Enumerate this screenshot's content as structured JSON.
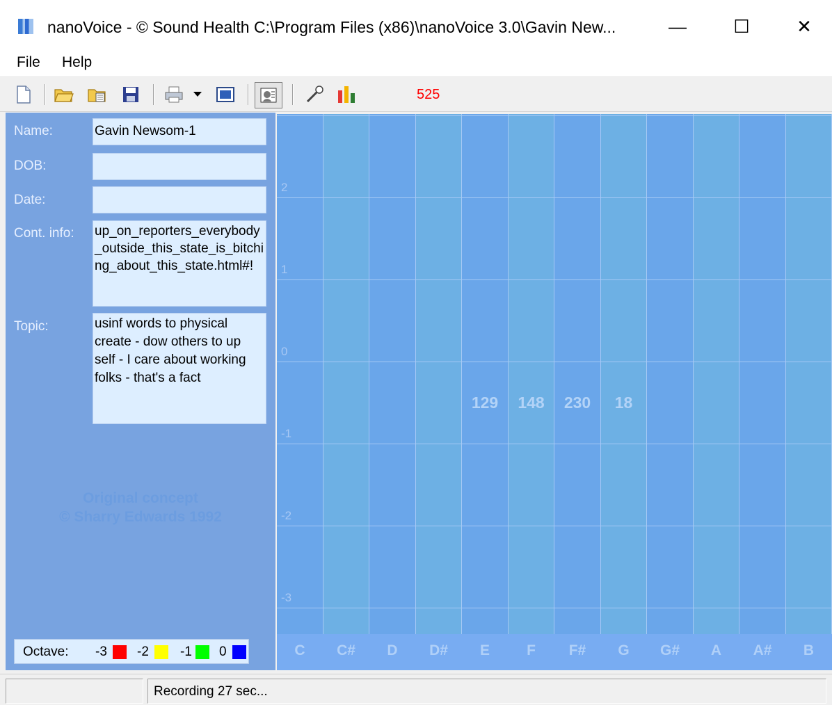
{
  "window": {
    "title": "nanoVoice - © Sound Health C:\\Program Files (x86)\\nanoVoice 3.0\\Gavin New...",
    "minimize_glyph": "—",
    "maximize_glyph": "☐",
    "close_glyph": "✕"
  },
  "menu": {
    "items": [
      {
        "label": "File"
      },
      {
        "label": "Help"
      }
    ]
  },
  "toolbar": {
    "icons": [
      "new-document-icon",
      "open-folder-icon",
      "open-file-icon",
      "save-icon",
      "print-icon",
      "dropdown-arrow-icon",
      "window-icon",
      "voice-analysis-icon",
      "microphone-icon",
      "bar-chart-icon"
    ],
    "counter": "525",
    "counter_color": "#ff0000"
  },
  "form": {
    "name_label": "Name:",
    "name_value": "Gavin Newsom-1",
    "dob_label": "DOB:",
    "dob_value": "",
    "date_label": "Date:",
    "date_value": "",
    "contact_label": "Cont. info:",
    "contact_value": "up_on_reporters_everybody_outside_this_state_is_bitching_about_this_state.html#!",
    "topic_label": "Topic:",
    "topic_value": "usinf words to physical create - dow others to up self - I care about working folks - that's a fact"
  },
  "watermark": {
    "line1": "Original concept",
    "line2": "© Sharry Edwards 1992"
  },
  "octave_legend": {
    "label": "Octave:",
    "items": [
      {
        "value": "-3",
        "color": "#ff0000"
      },
      {
        "value": "-2",
        "color": "#ffff00"
      },
      {
        "value": "-1",
        "color": "#00ff00"
      },
      {
        "value": "0",
        "color": "#0000ff"
      }
    ]
  },
  "grid": {
    "y_labels": [
      "2",
      "1",
      "0",
      "-1",
      "-2",
      "-3"
    ],
    "notes": [
      "C",
      "C#",
      "D",
      "D#",
      "E",
      "F",
      "F#",
      "G",
      "G#",
      "A",
      "A#",
      "B"
    ],
    "values": [
      {
        "note": "E",
        "value": "129"
      },
      {
        "note": "F",
        "value": "148"
      },
      {
        "note": "F#",
        "value": "230"
      },
      {
        "note": "G",
        "value": "18"
      }
    ]
  },
  "status": {
    "text": "Recording 27 sec..."
  }
}
